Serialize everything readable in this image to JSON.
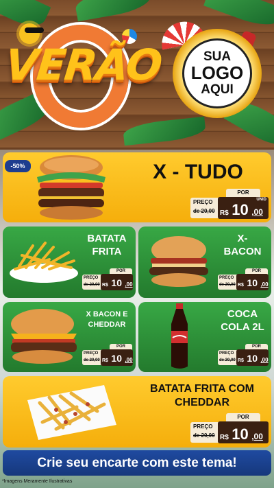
{
  "header": {
    "title": "VERÃO",
    "logo_line1": "SUA",
    "logo_line2": "LOGO",
    "logo_line3": "AQUI"
  },
  "discount_badge": "-50%",
  "price_labels": {
    "por": "POR",
    "preco": "PREÇO",
    "unid": "UNID"
  },
  "products": [
    {
      "name": "X - TUDO",
      "old_price": "de 20,00",
      "currency": "R$",
      "price_int": "10",
      "price_cents": ",00"
    },
    {
      "name_line1": "BATATA",
      "name_line2": "FRITA",
      "old_price": "de 20,00",
      "currency": "R$",
      "price_int": "10",
      "price_cents": ",00"
    },
    {
      "name_line1": "X-",
      "name_line2": "BACON",
      "old_price": "de 20,00",
      "currency": "R$",
      "price_int": "10",
      "price_cents": ",00"
    },
    {
      "name_line1": "X BACON E",
      "name_line2": "CHEDDAR",
      "old_price": "de 20,00",
      "currency": "R$",
      "price_int": "10",
      "price_cents": ",00"
    },
    {
      "name_line1": "COCA",
      "name_line2": "COLA 2L",
      "old_price": "de 20,00",
      "currency": "R$",
      "price_int": "10",
      "price_cents": ",00"
    },
    {
      "name_line1": "BATATA FRITA COM",
      "name_line2": "CHEDDAR",
      "old_price": "de 20,00",
      "currency": "R$",
      "price_int": "10",
      "price_cents": ",00"
    }
  ],
  "cta": "Crie seu encarte com este tema!",
  "disclaimer": "*Imagens Meramente Ilustrativas",
  "colors": {
    "yellow_card": "#f5ae0b",
    "green_card": "#2a8a36",
    "cta_blue": "#1f4aa0",
    "price_box": "#3a2012"
  }
}
